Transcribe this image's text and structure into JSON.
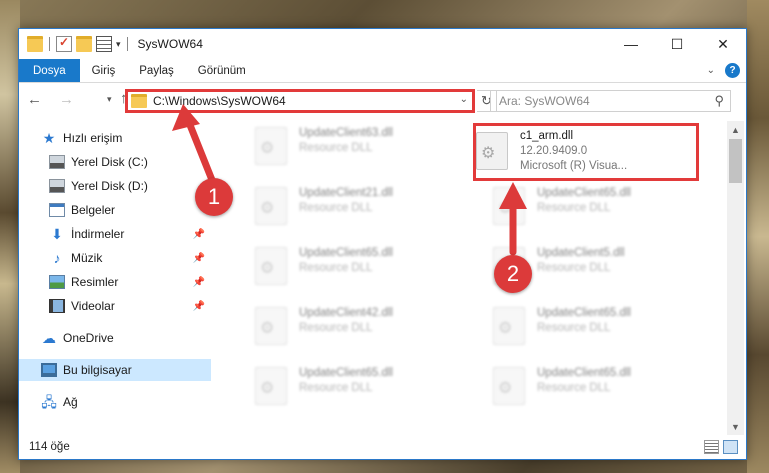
{
  "window": {
    "title": "SysWOW64",
    "controls": {
      "minimize": "—",
      "maximize": "☐",
      "close": "✕"
    }
  },
  "ribbon": {
    "tabs": [
      "Dosya",
      "Giriş",
      "Paylaş",
      "Görünüm"
    ],
    "expand_icon": "chevron-down-icon",
    "help_label": "?"
  },
  "address": {
    "path": "C:\\Windows\\SysWOW64",
    "search_placeholder": "Ara: SysWOW64"
  },
  "sidebar": {
    "items": [
      {
        "label": "Hızlı erişim",
        "icon": "star-icon",
        "pinned": false
      },
      {
        "label": "Yerel Disk (C:)",
        "icon": "disk-icon",
        "pinned": false
      },
      {
        "label": "Yerel Disk (D:)",
        "icon": "disk-icon",
        "pinned": false
      },
      {
        "label": "Belgeler",
        "icon": "documents-icon",
        "pinned": false
      },
      {
        "label": "İndirmeler",
        "icon": "download-icon",
        "pinned": true
      },
      {
        "label": "Müzik",
        "icon": "music-icon",
        "pinned": true
      },
      {
        "label": "Resimler",
        "icon": "pictures-icon",
        "pinned": true
      },
      {
        "label": "Videolar",
        "icon": "videos-icon",
        "pinned": true
      },
      {
        "label": "OneDrive",
        "icon": "cloud-icon",
        "pinned": false
      },
      {
        "label": "Bu bilgisayar",
        "icon": "computer-icon",
        "pinned": false
      },
      {
        "label": "Ağ",
        "icon": "network-icon",
        "pinned": false
      }
    ]
  },
  "files": {
    "left_column": [
      {
        "name": "UpdateClient63.dll",
        "type": "Resource DLL"
      },
      {
        "name": "UpdateClient21.dll",
        "type": "Resource DLL"
      },
      {
        "name": "UpdateClient65.dll",
        "type": "Resource DLL"
      },
      {
        "name": "UpdateClient42.dll",
        "type": "Resource DLL"
      },
      {
        "name": "UpdateClient65.dll",
        "type": "Resource DLL"
      }
    ],
    "right_column": [
      {
        "name": "UpdateClient65.dll",
        "type": "Resource DLL"
      },
      {
        "name": "UpdateClient5.dll",
        "type": "Resource DLL"
      },
      {
        "name": "UpdateClient65.dll",
        "type": "Resource DLL"
      },
      {
        "name": "UpdateClient65.dll",
        "type": "Resource DLL"
      }
    ],
    "highlighted": {
      "name": "c1_arm.dll",
      "version": "12.20.9409.0",
      "description": "Microsoft (R) Visua..."
    }
  },
  "status": {
    "item_count": "114 öğe"
  },
  "annotations": {
    "step1": "1",
    "step2": "2",
    "color": "#dc3a3a"
  }
}
